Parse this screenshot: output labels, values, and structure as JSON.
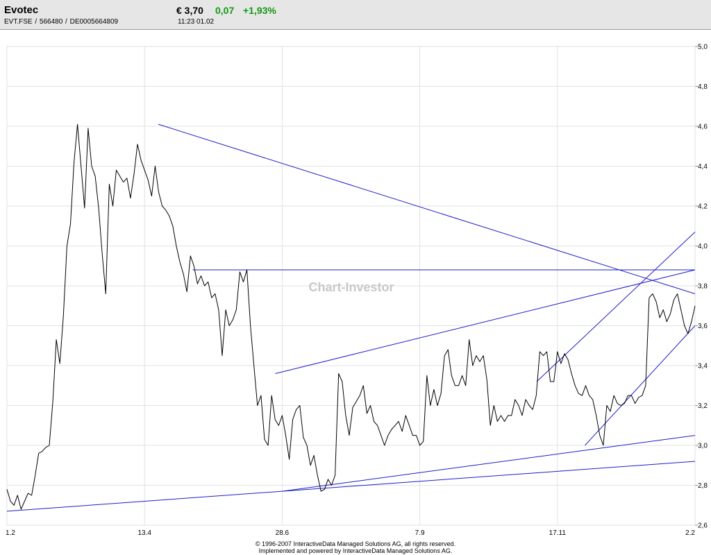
{
  "header": {
    "name": "Evotec",
    "ids": "EVT.FSE  /  566480  /  DE0005664809",
    "price": "€ 3,70",
    "change": "0,07",
    "change_pct": "+1,93%",
    "time": "11:23   01.02",
    "change_color": "#129912"
  },
  "chart_data": {
    "type": "line",
    "title": "",
    "watermark": "Chart-Investor",
    "x_tick_labels": [
      "1.2",
      "13.4",
      "28.6",
      "7.9",
      "17.11",
      "2.2"
    ],
    "y_tick_labels": [
      "2,6",
      "2,8",
      "3,0",
      "3,2",
      "3,4",
      "3,6",
      "3,8",
      "4,0",
      "4,2",
      "4,4",
      "4,6",
      "4,8",
      "5,0"
    ],
    "ylim": [
      2.6,
      5.0
    ],
    "grid": true,
    "line_color": "#000000",
    "trendline_color": "#1c1ccc",
    "series": [
      {
        "values": [
          2.78,
          2.72,
          2.7,
          2.75,
          2.68,
          2.72,
          2.76,
          2.75,
          2.85,
          2.96,
          2.97,
          2.99,
          3.0,
          3.22,
          3.53,
          3.41,
          3.65,
          4.0,
          4.11,
          4.42,
          4.61,
          4.4,
          4.19,
          4.59,
          4.4,
          4.35,
          4.19,
          3.96,
          3.76,
          4.31,
          4.2,
          4.38,
          4.35,
          4.32,
          4.34,
          4.24,
          4.36,
          4.51,
          4.43,
          4.38,
          4.33,
          4.25,
          4.4,
          4.27,
          4.2,
          4.18,
          4.15,
          4.1,
          4.0,
          3.92,
          3.86,
          3.77,
          3.95,
          3.9,
          3.81,
          3.85,
          3.8,
          3.82,
          3.74,
          3.76,
          3.68,
          3.45,
          3.68,
          3.6,
          3.63,
          3.68,
          3.87,
          3.82,
          3.88,
          3.6,
          3.4,
          3.2,
          3.25,
          3.03,
          3.0,
          3.25,
          3.13,
          3.1,
          3.15,
          3.05,
          2.93,
          3.13,
          3.18,
          3.2,
          3.04,
          3.0,
          2.9,
          2.95,
          2.85,
          2.77,
          2.78,
          2.83,
          2.8,
          2.85,
          3.36,
          3.32,
          3.15,
          3.05,
          3.19,
          3.22,
          3.25,
          3.3,
          3.16,
          3.2,
          3.12,
          3.1,
          3.05,
          3.0,
          3.05,
          3.08,
          3.1,
          3.12,
          3.07,
          3.15,
          3.1,
          3.05,
          3.05,
          3.0,
          3.02,
          3.35,
          3.2,
          3.28,
          3.2,
          3.26,
          3.45,
          3.48,
          3.35,
          3.3,
          3.3,
          3.35,
          3.3,
          3.53,
          3.4,
          3.45,
          3.42,
          3.45,
          3.33,
          3.1,
          3.2,
          3.12,
          3.15,
          3.12,
          3.15,
          3.15,
          3.23,
          3.2,
          3.15,
          3.23,
          3.2,
          3.18,
          3.25,
          3.47,
          3.45,
          3.47,
          3.32,
          3.32,
          3.47,
          3.41,
          3.46,
          3.43,
          3.36,
          3.3,
          3.26,
          3.25,
          3.3,
          3.25,
          3.23,
          3.15,
          3.05,
          3.0,
          3.2,
          3.17,
          3.25,
          3.21,
          3.2,
          3.21,
          3.25,
          3.25,
          3.21,
          3.24,
          3.25,
          3.3,
          3.74,
          3.76,
          3.72,
          3.64,
          3.68,
          3.62,
          3.66,
          3.73,
          3.76,
          3.68,
          3.6,
          3.56,
          3.62,
          3.7
        ]
      }
    ],
    "trendlines": [
      {
        "from": [
          0.22,
          4.61
        ],
        "to": [
          1.0,
          3.76
        ]
      },
      {
        "from": [
          0.0,
          2.67
        ],
        "to": [
          1.0,
          2.92
        ]
      },
      {
        "from": [
          0.4,
          2.77
        ],
        "to": [
          1.0,
          3.05
        ]
      },
      {
        "from": [
          0.39,
          3.36
        ],
        "to": [
          1.0,
          3.88
        ]
      },
      {
        "from": [
          0.77,
          3.32
        ],
        "to": [
          1.0,
          4.07
        ]
      },
      {
        "from": [
          0.84,
          3.0
        ],
        "to": [
          1.0,
          3.6
        ]
      },
      {
        "from": [
          0.27,
          3.88
        ],
        "to": [
          1.0,
          3.88
        ]
      }
    ]
  },
  "footer": {
    "line1": "© 1996-2007 InteractiveData Managed Solutions  AG, all rights reserved.",
    "line2": "Implemented and powered by  InteractiveData Managed Solutions  AG."
  }
}
